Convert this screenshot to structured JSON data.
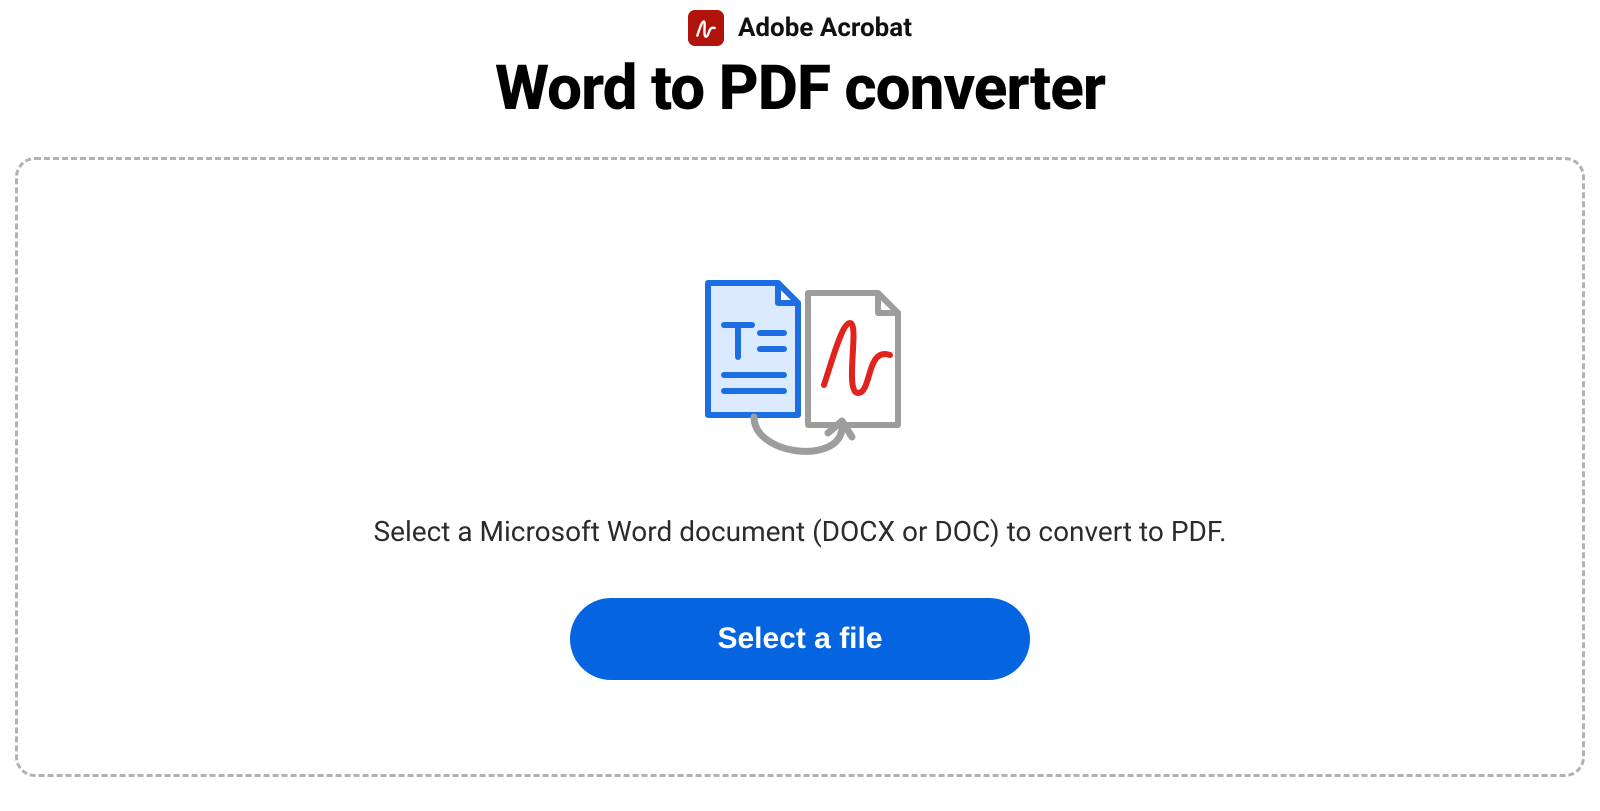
{
  "header": {
    "app_name": "Adobe Acrobat",
    "title": "Word to PDF converter"
  },
  "dropzone": {
    "instruction": "Select a Microsoft Word document (DOCX or DOC) to convert to PDF.",
    "button_label": "Select a file"
  },
  "colors": {
    "accent": "#0565e0",
    "badge": "#b1140b",
    "border": "#b2b2b2"
  }
}
